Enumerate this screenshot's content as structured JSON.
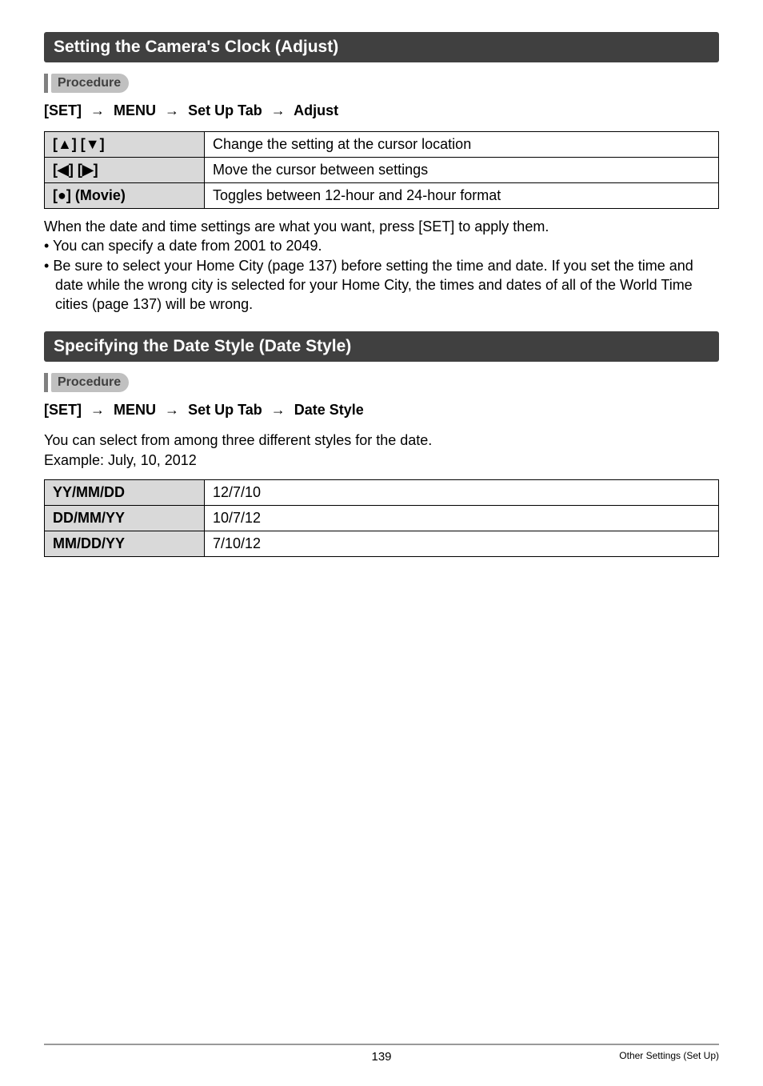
{
  "section1": {
    "title": "Setting the Camera's Clock (Adjust)",
    "procedure_label": "Procedure",
    "path": {
      "seg1": "[SET]",
      "seg2": "MENU",
      "seg3": "Set Up Tab",
      "seg4": "Adjust"
    },
    "table": [
      {
        "col1": "[▲] [▼]",
        "col2": "Change the setting at the cursor location"
      },
      {
        "col1": "[◀] [▶]",
        "col2": "Move the cursor between settings"
      },
      {
        "col1": "[●] (Movie)",
        "col2": "Toggles between 12-hour and 24-hour format"
      }
    ],
    "after_text": "When the date and time settings are what you want, press [SET] to apply them.",
    "bullets": [
      "You can specify a date from 2001 to 2049.",
      "Be sure to select your Home City (page 137) before setting the time and date. If you set the time and date while the wrong city is selected for your Home City, the times and dates of all of the World Time cities (page 137) will be wrong."
    ]
  },
  "section2": {
    "title": "Specifying the Date Style (Date Style)",
    "procedure_label": "Procedure",
    "path": {
      "seg1": "[SET]",
      "seg2": "MENU",
      "seg3": "Set Up Tab",
      "seg4": "Date Style"
    },
    "desc_line1": "You can select from among three different styles for the date.",
    "desc_line2": "Example: July, 10, 2012",
    "table": [
      {
        "col1": "YY/MM/DD",
        "col2": "12/7/10"
      },
      {
        "col1": "DD/MM/YY",
        "col2": "10/7/12"
      },
      {
        "col1": "MM/DD/YY",
        "col2": "7/10/12"
      }
    ]
  },
  "footer": {
    "page": "139",
    "right": "Other Settings (Set Up)"
  }
}
